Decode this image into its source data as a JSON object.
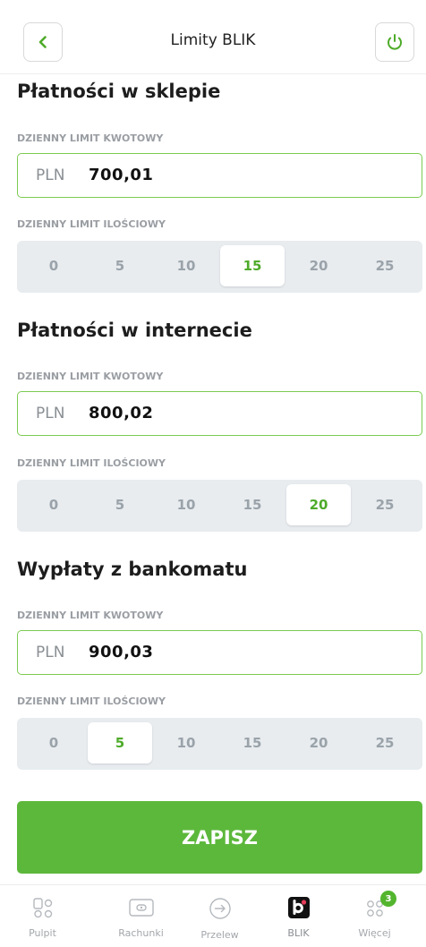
{
  "header": {
    "title": "Limity BLIK"
  },
  "sections": [
    {
      "title": "Płatności w sklepie",
      "amount_caption": "DZIENNY LIMIT KWOTOWY",
      "currency": "PLN",
      "amount": "700,01",
      "count_caption": "DZIENNY LIMIT ILOŚCIOWY",
      "options": [
        "0",
        "5",
        "10",
        "15",
        "20",
        "25"
      ],
      "selected": "15"
    },
    {
      "title": "Płatności w internecie",
      "amount_caption": "DZIENNY LIMIT KWOTOWY",
      "currency": "PLN",
      "amount": "800,02",
      "count_caption": "DZIENNY LIMIT ILOŚCIOWY",
      "options": [
        "0",
        "5",
        "10",
        "15",
        "20",
        "25"
      ],
      "selected": "20"
    },
    {
      "title": "Wypłaty z bankomatu",
      "amount_caption": "DZIENNY LIMIT KWOTOWY",
      "currency": "PLN",
      "amount": "900,03",
      "count_caption": "DZIENNY LIMIT ILOŚCIOWY",
      "options": [
        "0",
        "5",
        "10",
        "15",
        "20",
        "25"
      ],
      "selected": "5"
    }
  ],
  "save_label": "ZAPISZ",
  "nav": {
    "items": [
      {
        "label": "Pulpit",
        "icon": "dashboard-icon"
      },
      {
        "label": "Rachunki",
        "icon": "wallet-icon"
      },
      {
        "label": "Przelew",
        "icon": "transfer-icon"
      },
      {
        "label": "BLIK",
        "icon": "blik-icon",
        "active": true
      },
      {
        "label": "Więcej",
        "icon": "more-icon",
        "badge": "3"
      }
    ]
  },
  "colors": {
    "accent": "#5cb83b",
    "selected_text": "#4eab2a",
    "segment_bg": "#e8ecef"
  }
}
